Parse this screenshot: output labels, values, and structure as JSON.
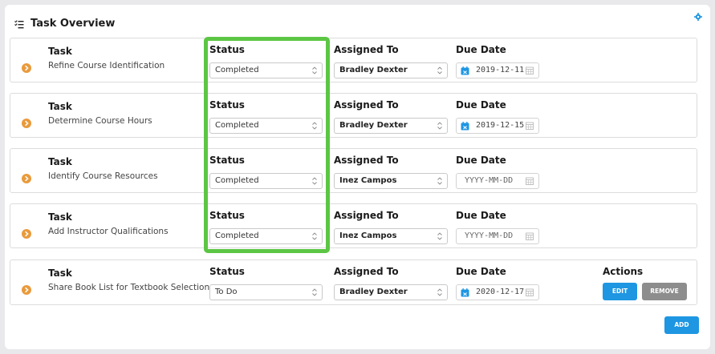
{
  "panel": {
    "title": "Task Overview"
  },
  "columns": {
    "task": "Task",
    "status": "Status",
    "assigned": "Assigned To",
    "due": "Due Date",
    "actions": "Actions"
  },
  "tasks": [
    {
      "name": "Refine Course Identification",
      "status": "Completed",
      "assignee": "Bradley Dexter",
      "due": "2019-12-11",
      "has_date": true
    },
    {
      "name": "Determine Course Hours",
      "status": "Completed",
      "assignee": "Bradley Dexter",
      "due": "2019-12-15",
      "has_date": true
    },
    {
      "name": "Identify Course Resources",
      "status": "Completed",
      "assignee": "Inez Campos",
      "due": "YYYY-MM-DD",
      "has_date": false
    },
    {
      "name": "Add Instructor Qualifications",
      "status": "Completed",
      "assignee": "Inez Campos",
      "due": "YYYY-MM-DD",
      "has_date": false
    },
    {
      "name": "Share Book List for Textbook Selection",
      "status": "To Do",
      "assignee": "Bradley Dexter",
      "due": "2020-12-17",
      "has_date": true
    }
  ],
  "buttons": {
    "edit": "EDIT",
    "remove": "REMOVE",
    "add": "ADD"
  },
  "colors": {
    "accent": "#1e96e2",
    "highlight": "#5cc644",
    "row_icon": "#e99a3c",
    "remove": "#8d8d8d"
  }
}
